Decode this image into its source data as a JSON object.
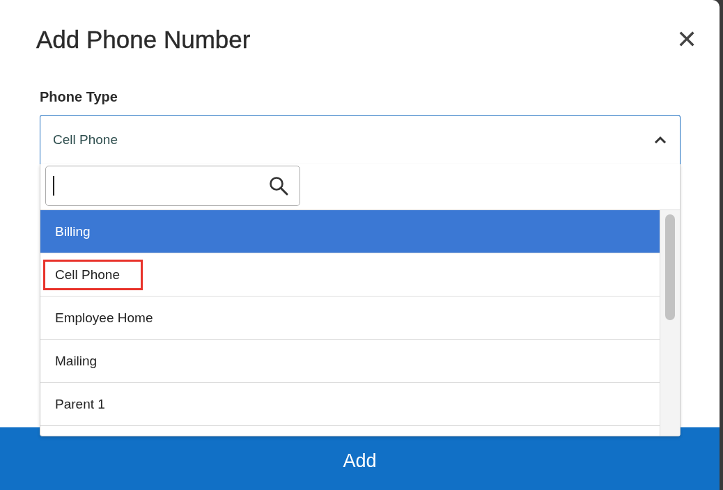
{
  "dialog": {
    "title": "Add Phone Number",
    "close_icon": "✕"
  },
  "phone_type": {
    "label": "Phone Type",
    "value": "Cell Phone",
    "expanded": true
  },
  "search": {
    "empty": true
  },
  "options": [
    {
      "label": "Billing",
      "selected": true,
      "outlined": false
    },
    {
      "label": "Cell Phone",
      "selected": false,
      "outlined": true
    },
    {
      "label": "Employee Home",
      "selected": false,
      "outlined": false
    },
    {
      "label": "Mailing",
      "selected": false,
      "outlined": false
    },
    {
      "label": "Parent 1",
      "selected": false,
      "outlined": false
    }
  ],
  "add_button": "Add"
}
